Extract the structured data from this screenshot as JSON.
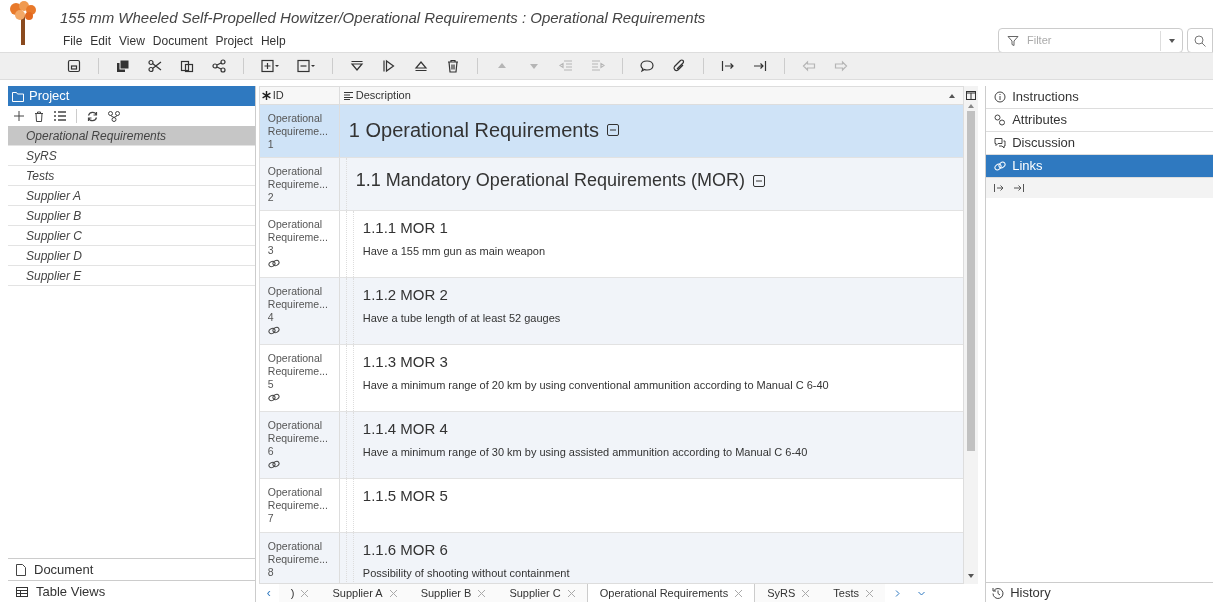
{
  "window": {
    "title": "155 mm Wheeled Self-Propelled Howitzer/Operational Requirements : Operational Requirements"
  },
  "menu": [
    "File",
    "Edit",
    "View",
    "Document",
    "Project",
    "Help"
  ],
  "filter": {
    "placeholder": "Filter"
  },
  "toolbar": [
    {
      "kind": "save",
      "disabled": false
    },
    {
      "kind": "sep"
    },
    {
      "kind": "copy",
      "disabled": false
    },
    {
      "kind": "cut",
      "disabled": false
    },
    {
      "kind": "paste",
      "disabled": false
    },
    {
      "kind": "share",
      "disabled": false
    },
    {
      "kind": "sep"
    },
    {
      "kind": "add-menu",
      "disabled": false
    },
    {
      "kind": "remove-menu",
      "disabled": false
    },
    {
      "kind": "sep"
    },
    {
      "kind": "down-tri",
      "disabled": false
    },
    {
      "kind": "play",
      "disabled": false
    },
    {
      "kind": "eject",
      "disabled": false
    },
    {
      "kind": "trash",
      "disabled": false
    },
    {
      "kind": "sep"
    },
    {
      "kind": "up",
      "disabled": true
    },
    {
      "kind": "down",
      "disabled": true
    },
    {
      "kind": "outdent",
      "disabled": true
    },
    {
      "kind": "indent",
      "disabled": true
    },
    {
      "kind": "sep"
    },
    {
      "kind": "comment",
      "disabled": false
    },
    {
      "kind": "clip",
      "disabled": false
    },
    {
      "kind": "sep"
    },
    {
      "kind": "link-in",
      "disabled": false
    },
    {
      "kind": "link-end",
      "disabled": false
    },
    {
      "kind": "sep"
    },
    {
      "kind": "back",
      "disabled": true
    },
    {
      "kind": "forward",
      "disabled": true
    }
  ],
  "project": {
    "title": "Project",
    "items": [
      {
        "label": "Operational Requirements",
        "selected": true
      },
      {
        "label": "SyRS",
        "selected": false
      },
      {
        "label": "Tests",
        "selected": false
      },
      {
        "label": "Supplier A",
        "selected": false
      },
      {
        "label": "Supplier B",
        "selected": false
      },
      {
        "label": "Supplier C",
        "selected": false
      },
      {
        "label": "Supplier D",
        "selected": false
      },
      {
        "label": "Supplier E",
        "selected": false
      }
    ],
    "bottom": [
      {
        "kind": "document",
        "label": "Document"
      },
      {
        "kind": "table",
        "label": "Table Views"
      }
    ]
  },
  "table": {
    "columns": [
      "ID",
      "Description"
    ],
    "rows": [
      {
        "id": "Operational Requireme...",
        "number": "1",
        "linked": false,
        "selected": true,
        "kind": "heading",
        "title": "1 Operational Requirements",
        "expanded": true,
        "children": [
          {
            "id": "Operational Requireme...",
            "number": "2",
            "linked": false,
            "selected": false,
            "kind": "heading",
            "title": "1.1 Mandatory Operational Requirements (MOR)",
            "expanded": true,
            "children": [
              {
                "id": "Operational Requireme...",
                "number": "3",
                "linked": true,
                "selected": false,
                "kind": "requirement",
                "title": "1.1.1 MOR 1",
                "text": "Have a 155 mm gun as main weapon"
              },
              {
                "id": "Operational Requireme...",
                "number": "4",
                "linked": true,
                "selected": false,
                "kind": "requirement",
                "title": "1.1.2 MOR 2",
                "text": "Have a tube length of at least 52 gauges"
              },
              {
                "id": "Operational Requireme...",
                "number": "5",
                "linked": true,
                "selected": false,
                "kind": "requirement",
                "title": "1.1.3 MOR 3",
                "text": "Have a minimum range of 20 km by using conventional ammunition according to Manual C 6-40"
              },
              {
                "id": "Operational Requireme...",
                "number": "6",
                "linked": true,
                "selected": false,
                "kind": "requirement",
                "title": "1.1.4 MOR 4",
                "text": "Have a minimum range of 30 km by using assisted ammunition according to Manual C 6-40"
              },
              {
                "id": "Operational Requireme...",
                "number": "7",
                "linked": false,
                "selected": false,
                "kind": "requirement",
                "title": "1.1.5 MOR 5"
              },
              {
                "id": "Operational Requireme...",
                "number": "8",
                "linked": false,
                "selected": false,
                "kind": "requirement",
                "title": "1.1.6 MOR 6",
                "text": "Possibility of shooting without containment"
              }
            ]
          }
        ]
      }
    ]
  },
  "tab_scroll": {
    "left": "‹"
  },
  "tabs": [
    {
      "label": ")",
      "selected": false
    },
    {
      "label": "Supplier A",
      "selected": false
    },
    {
      "label": "Supplier B",
      "selected": false
    },
    {
      "label": "Supplier C",
      "selected": false
    },
    {
      "label": "Operational Requirements",
      "selected": true
    },
    {
      "label": "SyRS",
      "selected": false
    },
    {
      "label": "Tests",
      "selected": false
    }
  ],
  "side": {
    "sections": [
      {
        "kind": "info",
        "label": "Instructions",
        "selected": false
      },
      {
        "kind": "attributes",
        "label": "Attributes",
        "selected": false
      },
      {
        "kind": "discussion",
        "label": "Discussion",
        "selected": false
      },
      {
        "kind": "links",
        "label": "Links",
        "selected": true
      }
    ],
    "history": "History"
  }
}
